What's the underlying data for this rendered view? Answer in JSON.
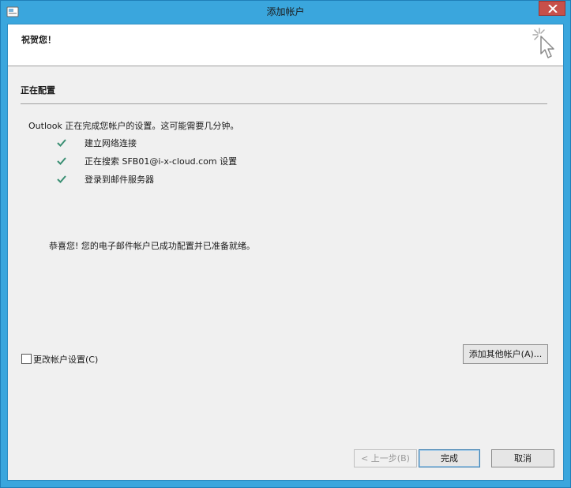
{
  "window": {
    "title": "添加帐户",
    "colors": {
      "titlebar": "#3aa6dd",
      "close": "#c7504a",
      "check": "#3a8f73"
    }
  },
  "banner": {
    "title": "祝贺您！",
    "icon": "cursor-sparkle-icon"
  },
  "section": {
    "title": "正在配置"
  },
  "status": {
    "text": "Outlook 正在完成您帐户的设置。这可能需要几分钟。",
    "steps": [
      {
        "icon": "check-icon",
        "label": "建立网络连接"
      },
      {
        "icon": "check-icon",
        "label": "正在搜索 SFB01@i-x-cloud.com 设置"
      },
      {
        "icon": "check-icon",
        "label": "登录到邮件服务器"
      }
    ],
    "success": "恭喜您! 您的电子邮件帐户已成功配置并已准备就绪。"
  },
  "options": {
    "change_settings_label": "更改帐户设置(C)",
    "change_settings_checked": false
  },
  "buttons": {
    "add_other": "添加其他帐户(A)...",
    "back": "< 上一步(B)",
    "finish": "完成",
    "cancel": "取消"
  }
}
